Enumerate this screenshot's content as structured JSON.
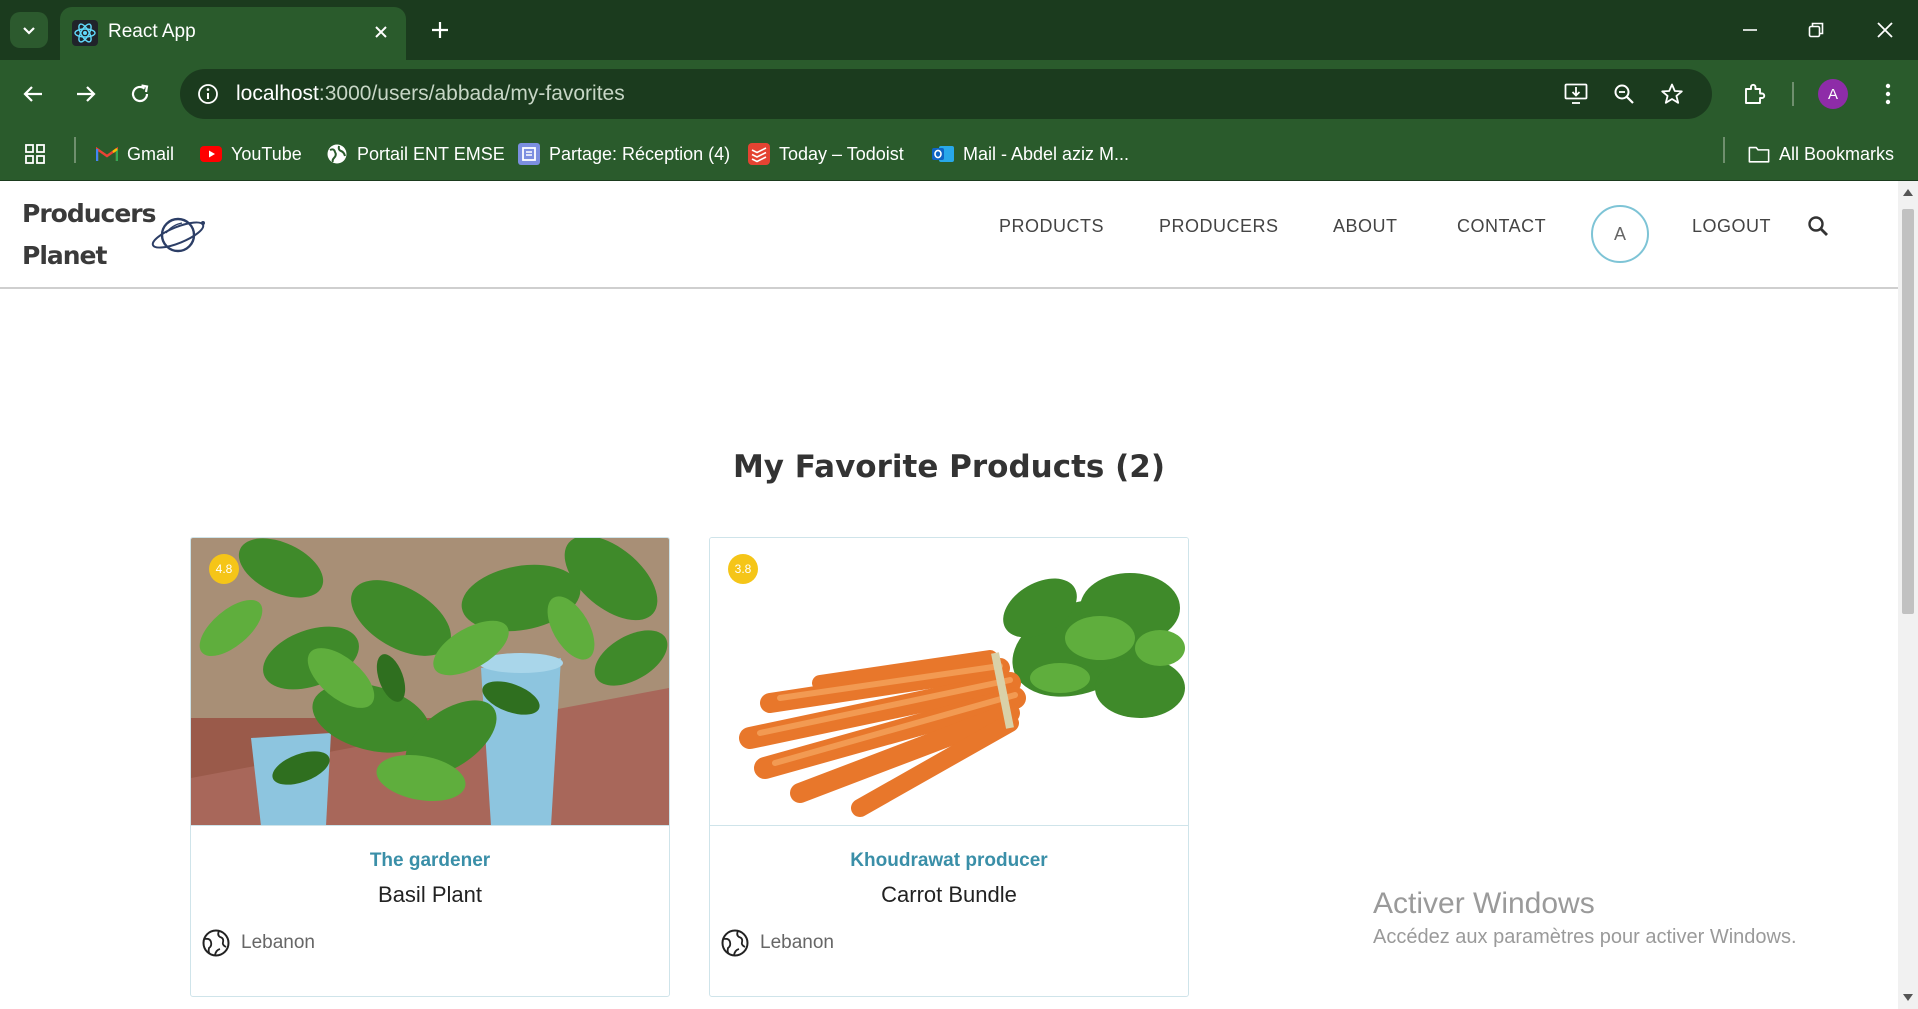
{
  "browser": {
    "tab_title": "React App",
    "url_host": "localhost",
    "url_path": ":3000/users/abbada/my-favorites",
    "profile_initial": "A",
    "bookmarks": [
      {
        "label": "Gmail",
        "icon": "gmail-icon"
      },
      {
        "label": "YouTube",
        "icon": "youtube-icon"
      },
      {
        "label": "Portail ENT EMSE",
        "icon": "globe-icon"
      },
      {
        "label": "Partage: Réception (4)",
        "icon": "partage-icon"
      },
      {
        "label": "Today – Todoist",
        "icon": "todoist-icon"
      },
      {
        "label": "Mail - Abdel aziz M...",
        "icon": "outlook-icon"
      }
    ],
    "all_bookmarks": "All Bookmarks"
  },
  "site": {
    "logo_line1": "Producers",
    "logo_line2": "Planet",
    "nav": {
      "products": "PRODUCTS",
      "producers": "PRODUCERS",
      "about": "ABOUT",
      "contact": "CONTACT",
      "avatar": "A",
      "logout": "LOGOUT"
    }
  },
  "main": {
    "title": "My Favorite Products (2)",
    "products": [
      {
        "rating": "4.8",
        "producer": "The gardener",
        "name": "Basil Plant",
        "location": "Lebanon"
      },
      {
        "rating": "3.8",
        "producer": "Khoudrawat producer",
        "name": "Carrot Bundle",
        "location": "Lebanon"
      }
    ]
  },
  "watermark": {
    "title": "Activer Windows",
    "subtitle": "Accédez aux paramètres pour activer Windows."
  },
  "colors": {
    "chrome_dark": "#1b3b1e",
    "chrome": "#2a5b2c",
    "producer_link": "#3a8fa8",
    "rating_badge": "#f5c518"
  }
}
